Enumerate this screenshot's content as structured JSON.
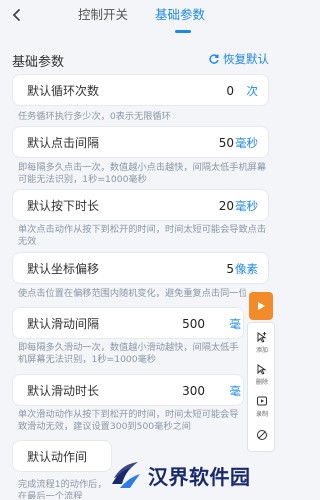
{
  "header": {
    "tabs": [
      {
        "label": "控制开关",
        "active": false
      },
      {
        "label": "基础参数",
        "active": true
      }
    ]
  },
  "section": {
    "title": "基础参数",
    "restore_label": "恢复默认"
  },
  "settings": [
    {
      "label": "默认循环次数",
      "value": "0",
      "unit": "次",
      "desc": "任务循环执行多少次，0表示无限循环"
    },
    {
      "label": "默认点击间隔",
      "value": "50",
      "unit": "毫秒",
      "desc": "即每隔多久点击一次，数值越小点击越快，间隔太低手机屏幕可能无法识别，1秒=1000毫秒"
    },
    {
      "label": "默认按下时长",
      "value": "20",
      "unit": "毫秒",
      "desc": "单次点击动作从按下到松开的时间，时间太短可能会导致点击无效"
    },
    {
      "label": "默认坐标偏移",
      "value": "5",
      "unit": "像素",
      "desc": "使点击位置在偏移范围内随机变化，避免重复点击同一位"
    },
    {
      "label": "默认滑动间隔",
      "value": "500",
      "unit": "毫",
      "desc": "即每隔多久滑动一次，数值越小滑动越快，间隔太低手机屏幕无法识别，1秒=1000毫秒"
    },
    {
      "label": "默认滑动时长",
      "value": "300",
      "unit": "毫",
      "desc": "单次滑动动作从按下到松开的时间，时间太短可能会导致滑动无效，建议设置300到500毫秒之间"
    },
    {
      "label": "默认动作间",
      "value": "",
      "unit": "",
      "desc": "完成流程1的动作后，在最后一个流程"
    }
  ],
  "float_toolbar": {
    "buttons": [
      {
        "label": "添加",
        "icon": "add-pointer-icon"
      },
      {
        "label": "删除",
        "icon": "delete-pointer-icon"
      },
      {
        "label": "录制",
        "icon": "record-icon"
      },
      {
        "label": "",
        "icon": "hide-icon"
      }
    ]
  },
  "watermark": {
    "text": "汉界软件园"
  },
  "colors": {
    "accent": "#1e88e5",
    "play": "#f28c2b",
    "background": "#f3f5f8"
  }
}
